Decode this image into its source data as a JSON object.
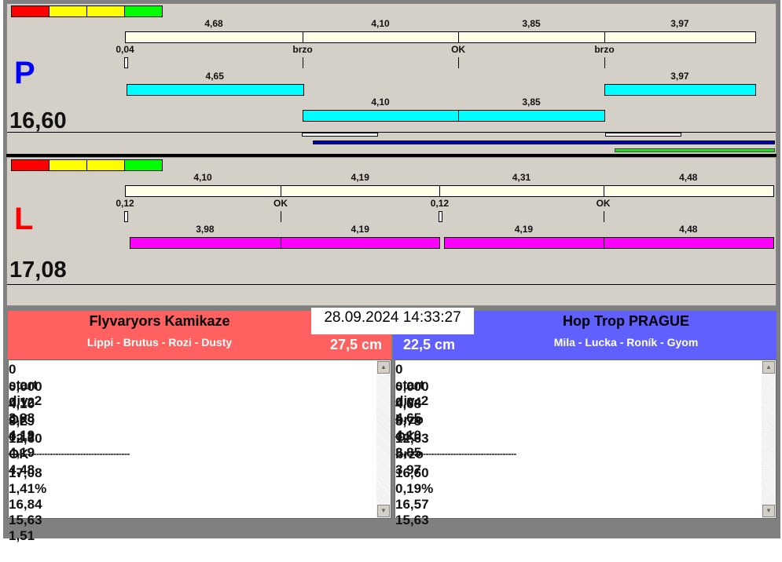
{
  "signal_colors": [
    "#ff0000",
    "#ffff00",
    "#ffff00",
    "#00ff00"
  ],
  "lanes": {
    "P": {
      "letter": "P",
      "letter_color": "#0000ff",
      "total": "16,60",
      "runs": [
        {
          "value": 4.68,
          "label": "4,68"
        },
        {
          "value": 4.1,
          "label": "4,10"
        },
        {
          "value": 3.85,
          "label": "3,85"
        },
        {
          "value": 3.97,
          "label": "3,97"
        }
      ],
      "markers": [
        "0,04",
        "brzo",
        "OK",
        "brzo"
      ],
      "start_reaction": 0.04,
      "dogs": [
        {
          "value": 4.65,
          "label": "4,65",
          "gap": 0
        },
        {
          "value": 4.1,
          "label": "4,10",
          "gap": 0
        },
        {
          "value": 3.85,
          "label": "3,85",
          "gap": 0
        },
        {
          "value": 3.97,
          "label": "3,97",
          "gap": 0
        }
      ],
      "dog_color": "#00ffff"
    },
    "L": {
      "letter": "L",
      "letter_color": "#ff0000",
      "total": "17,08",
      "runs": [
        {
          "value": 4.1,
          "label": "4,10"
        },
        {
          "value": 4.19,
          "label": "4,19"
        },
        {
          "value": 4.31,
          "label": "4,31"
        },
        {
          "value": 4.48,
          "label": "4,48"
        }
      ],
      "markers": [
        "0,12",
        "OK",
        "0,12",
        "OK"
      ],
      "start_reaction": 0.12,
      "dogs": [
        {
          "value": 3.98,
          "label": "3,98",
          "gap": 0
        },
        {
          "value": 4.19,
          "label": "4,19",
          "gap": 0
        },
        {
          "value": 4.19,
          "label": "4,19",
          "gap": 0.12
        },
        {
          "value": 4.48,
          "label": "4,48",
          "gap": 0
        }
      ],
      "dog_color": "#ff00ff"
    }
  },
  "timestamp": "28.09.2024 14:33:27",
  "teams": {
    "left": {
      "name": "Flyvaryors Kamikaze",
      "dogs": "Lippi - Brutus - Rozi - Dusty",
      "height": "27,5 cm",
      "color": "#ff6060",
      "header": [
        "0",
        "start",
        "div. 2"
      ],
      "rows": [
        [
          "0,000",
          "0,12",
          "3,98"
        ],
        [
          "4,10",
          "OK",
          "4,19"
        ],
        [
          "8,29",
          "0,12",
          "4,19"
        ],
        [
          "12,60",
          "OK",
          "4,48"
        ]
      ],
      "divider": "--------------------------------------------",
      "summary": [
        "17,08",
        "1,41%",
        "16,84",
        "15,63",
        "1,51"
      ]
    },
    "right": {
      "name": "Hop Trop PRAGUE",
      "dogs": "Mila - Lucka - Roník - Gyom",
      "height": "22,5 cm",
      "color": "#6060ff",
      "header": [
        "0",
        "start",
        "div. 2"
      ],
      "rows": [
        [
          "0,000",
          "0,04",
          "4,65"
        ],
        [
          "4,68",
          "brzo",
          "4,10"
        ],
        [
          "8,78",
          "OK",
          "3,85"
        ],
        [
          "12,63",
          "brzo",
          "3,97"
        ]
      ],
      "divider": "--------------------------------------------",
      "summary": [
        "16,60",
        "0,19%",
        "16,57",
        "15,63"
      ]
    }
  }
}
